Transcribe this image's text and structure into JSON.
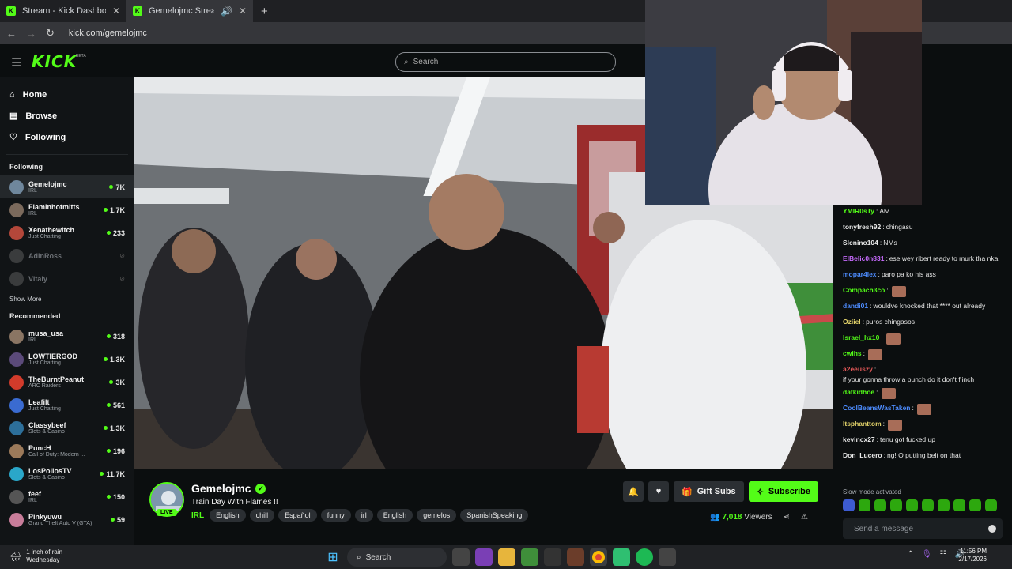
{
  "browser": {
    "tabs": [
      {
        "label": "Stream - Kick Dashboard"
      },
      {
        "label": "Gemelojmc Stream - Watch"
      }
    ],
    "url": "kick.com/gemelojmc"
  },
  "header": {
    "logo": "KICK",
    "beta": "BETA",
    "search_placeholder": "Search"
  },
  "sidebar": {
    "nav": [
      {
        "label": "Home",
        "icon": "home-icon"
      },
      {
        "label": "Browse",
        "icon": "browse-icon"
      },
      {
        "label": "Following",
        "icon": "heart-icon"
      }
    ],
    "following_title": "Following",
    "following": [
      {
        "name": "Gemelojmc",
        "category": "IRL",
        "viewers": "7K",
        "online": true,
        "color": "#6f879c"
      },
      {
        "name": "Flaminhotmitts",
        "category": "IRL",
        "viewers": "1.7K",
        "online": true,
        "color": "#7b6a5c"
      },
      {
        "name": "Xenathewitch",
        "category": "Just Chatting",
        "viewers": "233",
        "online": true,
        "color": "#b3473a"
      },
      {
        "name": "AdinRoss",
        "category": "",
        "viewers": "",
        "online": false,
        "color": "#888888"
      },
      {
        "name": "Vitaly",
        "category": "",
        "viewers": "",
        "online": false,
        "color": "#888888"
      }
    ],
    "show_more": "Show More",
    "recommended_title": "Recommended",
    "recommended": [
      {
        "name": "musa_usa",
        "category": "IRL",
        "viewers": "318",
        "color": "#8a7563"
      },
      {
        "name": "LOWTIERGOD",
        "category": "Just Chatting",
        "viewers": "1.3K",
        "color": "#5b4a7a"
      },
      {
        "name": "TheBurntPeanut",
        "category": "ARC Raiders",
        "viewers": "3K",
        "color": "#d23b2b"
      },
      {
        "name": "Leafilt",
        "category": "Just Chatting",
        "viewers": "561",
        "color": "#3a6bd1"
      },
      {
        "name": "Classybeef",
        "category": "Slots & Casino",
        "viewers": "1.3K",
        "color": "#2d6f9a"
      },
      {
        "name": "PuncH",
        "category": "Call of Duty: Modern ...",
        "viewers": "196",
        "color": "#9c7a5a"
      },
      {
        "name": "LosPollosTV",
        "category": "Slots & Casino",
        "viewers": "11.7K",
        "color": "#2aa7c9"
      },
      {
        "name": "feef",
        "category": "IRL",
        "viewers": "150",
        "color": "#555555"
      },
      {
        "name": "Pinkyuwu",
        "category": "Grand Theft Auto V (GTA)",
        "viewers": "59",
        "color": "#c87d9a"
      }
    ]
  },
  "stream": {
    "name": "Gemelojmc",
    "live": "LIVE",
    "title": "Train Day With Flames !!",
    "category": "IRL",
    "tags": [
      "English",
      "chill",
      "Español",
      "funny",
      "irl",
      "English",
      "gemelos",
      "SpanishSpeaking"
    ],
    "gift_label": "Gift Subs",
    "subscribe_label": "Subscribe",
    "viewers_count": "7,018",
    "viewers_label": "Viewers"
  },
  "chat": {
    "messages": [
      {
        "user": "YMIR0sTy",
        "text": "Alv",
        "color": "#53fc18",
        "emote": false
      },
      {
        "user": "tonyfresh92",
        "text": "chingasu",
        "color": "#e8e8e8",
        "emote": false
      },
      {
        "user": "Slcnino104",
        "text": "NMs",
        "color": "#e8e8e8",
        "emote": false
      },
      {
        "user": "ElBelic0n831",
        "text": "ese wey ribert ready to murk tha nka",
        "color": "#c86bff",
        "emote": false
      },
      {
        "user": "mopar4lex",
        "text": "paro pa ko his ass",
        "color": "#4d8cff",
        "emote": false
      },
      {
        "user": "Compach3co",
        "text": "",
        "color": "#53fc18",
        "emote": true
      },
      {
        "user": "dandi01",
        "text": "wouldve knocked that **** out already",
        "color": "#4d8cff",
        "emote": false
      },
      {
        "user": "Oziiel",
        "text": "puros chingasos",
        "color": "#e3d36a",
        "emote": false
      },
      {
        "user": "Israel_hx10",
        "text": "",
        "color": "#53fc18",
        "emote": true
      },
      {
        "user": "cwihs",
        "text": "",
        "color": "#53fc18",
        "emote": true
      },
      {
        "user": "a2eeuszy",
        "text": "if your gonna throw a punch do it don't flinch",
        "color": "#e05757",
        "emote": false
      },
      {
        "user": "datkidhoe",
        "text": "",
        "color": "#53fc18",
        "emote": true
      },
      {
        "user": "CoolBeansWasTaken",
        "text": "",
        "color": "#4d8cff",
        "emote": true
      },
      {
        "user": "Itsphanttom",
        "text": "",
        "color": "#e3d36a",
        "emote": true
      },
      {
        "user": "kevincx27",
        "text": "tenu got fucked up",
        "color": "#e8e8e8",
        "emote": false
      },
      {
        "user": "Don_Lucero",
        "text": "ng! O putting belt on that",
        "color": "#e8e8e8",
        "emote": false
      }
    ],
    "slow_mode": "Slow mode activated",
    "input_placeholder": "Send a message"
  },
  "taskbar": {
    "weather_line1": "1 inch of rain",
    "weather_line2": "Wednesday",
    "search_label": "Search",
    "time": "11:56 PM",
    "date": "2/17/2026"
  }
}
